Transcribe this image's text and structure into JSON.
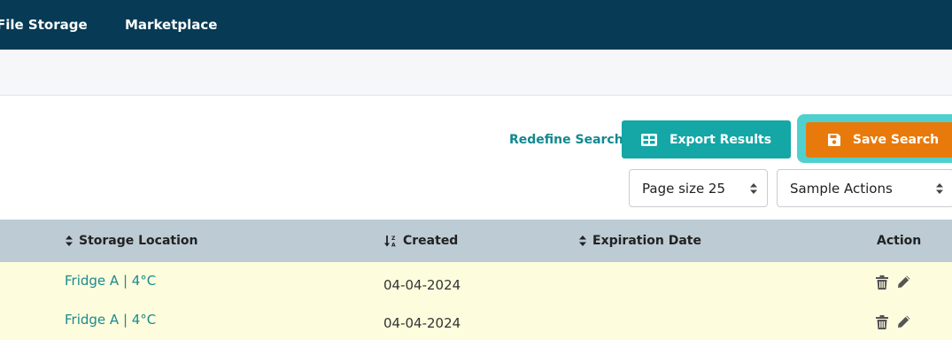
{
  "nav": {
    "items": [
      "File Storage",
      "Marketplace"
    ]
  },
  "toolbar": {
    "redefine_label": "Redefine Search",
    "export_label": "Export Results",
    "save_label": "Save Search",
    "page_size_value": "Page size 25",
    "sample_actions_value": "Sample Actions"
  },
  "table": {
    "columns": [
      "Storage Location",
      "Created",
      "Expiration Date",
      "Action"
    ],
    "rows": [
      {
        "location": "Fridge A | 4°C",
        "created": "04-04-2024",
        "expiration": ""
      },
      {
        "location": "Fridge A | 4°C",
        "created": "04-04-2024",
        "expiration": ""
      }
    ]
  },
  "colors": {
    "nav_bg": "#063a55",
    "export_bg": "#14a7a6",
    "save_bg": "#e87a0c",
    "row_bg": "#fdfcdd",
    "header_bg": "#bccbd4",
    "link": "#1b8a8e"
  },
  "icons": [
    "table-icon",
    "save-icon",
    "sort-icon",
    "sort-alpha-down-icon",
    "select-caret-icon",
    "trash-icon",
    "pencil-icon"
  ]
}
